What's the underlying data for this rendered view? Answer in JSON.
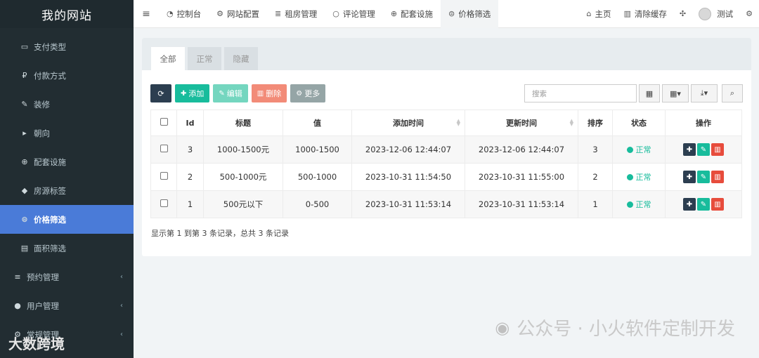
{
  "sidebar": {
    "logo": "我的网站",
    "items": [
      {
        "icon": "credit-card-icon",
        "glyph": "▭",
        "label": "支付类型"
      },
      {
        "icon": "paypal-icon",
        "glyph": "₽",
        "label": "付款方式"
      },
      {
        "icon": "wrench-icon",
        "glyph": "✎",
        "label": "装修"
      },
      {
        "icon": "play-square-icon",
        "glyph": "▸",
        "label": "朝向"
      },
      {
        "icon": "life-ring-icon",
        "glyph": "⊕",
        "label": "配套设施"
      },
      {
        "icon": "tag-icon",
        "glyph": "◆",
        "label": "房源标签"
      },
      {
        "icon": "price-icon",
        "glyph": "⊜",
        "label": "价格筛选",
        "active": true
      },
      {
        "icon": "area-icon",
        "glyph": "▤",
        "label": "面积筛选"
      }
    ],
    "groups": [
      {
        "icon": "list-icon",
        "glyph": "≡",
        "label": "预约管理"
      },
      {
        "icon": "user-icon",
        "glyph": "●",
        "label": "用户管理"
      },
      {
        "icon": "cog-icon",
        "glyph": "⚙",
        "label": "常规管理"
      }
    ]
  },
  "topbar": {
    "tabs": [
      {
        "icon": "dashboard-icon",
        "glyph": "◔",
        "label": "控制台"
      },
      {
        "icon": "cogs-icon",
        "glyph": "⚙",
        "label": "网站配置"
      },
      {
        "icon": "list-icon",
        "glyph": "≣",
        "label": "租房管理"
      },
      {
        "icon": "comment-icon",
        "glyph": "○",
        "label": "评论管理"
      },
      {
        "icon": "life-ring-icon",
        "glyph": "⊕",
        "label": "配套设施"
      },
      {
        "icon": "price-icon",
        "glyph": "⊜",
        "label": "价格筛选",
        "active": true
      }
    ],
    "home_label": "主页",
    "clear_cache_label": "清除缓存",
    "user_name": "测试"
  },
  "panel": {
    "tabs": [
      "全部",
      "正常",
      "隐藏"
    ],
    "buttons": {
      "add": "添加",
      "edit": "编辑",
      "delete": "删除",
      "more": "更多"
    },
    "search_placeholder": "搜索",
    "columns": [
      "Id",
      "标题",
      "值",
      "添加时间",
      "更新时间",
      "排序",
      "状态",
      "操作"
    ],
    "rows": [
      {
        "id": "3",
        "title": "1000-1500元",
        "value": "1000-1500",
        "created": "2023-12-06 12:44:07",
        "updated": "2023-12-06 12:44:07",
        "weigh": "3",
        "status": "正常"
      },
      {
        "id": "2",
        "title": "500-1000元",
        "value": "500-1000",
        "created": "2023-10-31 11:54:50",
        "updated": "2023-10-31 11:55:00",
        "weigh": "2",
        "status": "正常"
      },
      {
        "id": "1",
        "title": "500元以下",
        "value": "0-500",
        "created": "2023-10-31 11:53:14",
        "updated": "2023-10-31 11:53:14",
        "weigh": "1",
        "status": "正常"
      }
    ],
    "page_info": "显示第 1 到第 3 条记录，总共 3 条记录"
  },
  "watermark": {
    "text": "公众号 · 小火软件定制开发",
    "corner_text": "大数跨境"
  },
  "colors": {
    "sidebar_bg": "#222d32",
    "active_item": "#4a7bd8",
    "success": "#18bc9c",
    "danger": "#e74c3c",
    "primary_dark": "#2c3e50"
  }
}
